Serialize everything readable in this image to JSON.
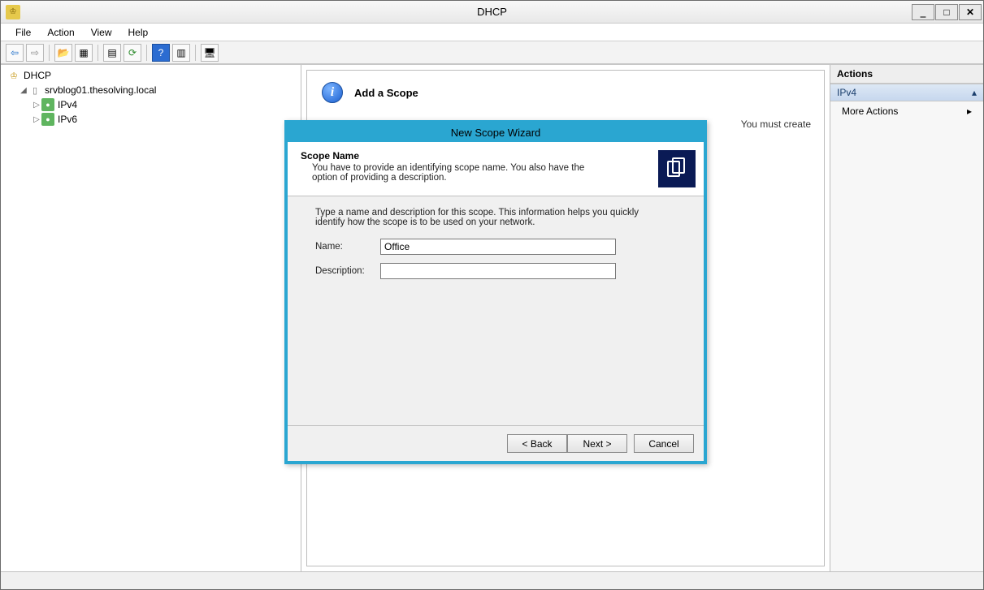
{
  "titlebar": {
    "title": "DHCP"
  },
  "menubar": {
    "items": [
      "File",
      "Action",
      "View",
      "Help"
    ]
  },
  "toolbar_icons": {
    "back": "⇦",
    "forward": "⇨",
    "up": "📂",
    "properties": "▦",
    "list": "▤",
    "refresh": "⟳",
    "help": "?",
    "views": "▥",
    "monitor": "🖥"
  },
  "tree": {
    "root": "DHCP",
    "server": "srvblog01.thesolving.local",
    "ipv4": "IPv4",
    "ipv6": "IPv6"
  },
  "center": {
    "info_title": "Add a Scope",
    "info_body_frag": "You must create"
  },
  "actions": {
    "header": "Actions",
    "section_title": "IPv4",
    "more_label": "More Actions"
  },
  "wizard": {
    "title": "New Scope Wizard",
    "head_title": "Scope Name",
    "head_sub": "You have to provide an identifying scope name. You also have the option of providing a description.",
    "intro": "Type a name and description for this scope. This information helps you quickly identify how the scope is to be used on your network.",
    "name_label": "Name:",
    "name_value": "Office",
    "desc_label": "Description:",
    "desc_value": "",
    "back": "< Back",
    "next": "Next >",
    "cancel": "Cancel"
  }
}
